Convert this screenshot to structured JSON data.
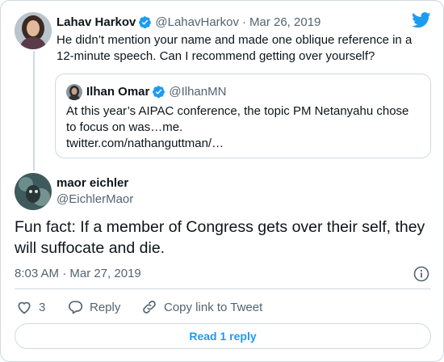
{
  "colors": {
    "twitter_blue": "#1d9bf0",
    "muted_text": "#536471",
    "border": "#cfd9de"
  },
  "parent_tweet": {
    "author_name": "Lahav Harkov",
    "handle": "@LahavHarkov",
    "separator": "·",
    "date": "Mar 26, 2019",
    "verified_icon": "verified-badge-icon",
    "text": "He didn’t mention your name and made one oblique reference in a 12-minute speech. Can I recommend getting over yourself?"
  },
  "quoted_tweet": {
    "author_name": "Ilhan Omar",
    "handle": "@IlhanMN",
    "verified_icon": "verified-badge-icon",
    "text": "At this year’s AIPAC conference, the topic PM Netanyahu chose to focus on was…me.",
    "link": "twitter.com/nathanguttman/…"
  },
  "main_tweet": {
    "author_name": "maor eichler",
    "handle": "@EichlerMaor",
    "text": "Fun fact: If a member of Congress gets over their self, they will suffocate and die.",
    "timestamp": "8:03 AM · Mar 27, 2019"
  },
  "actions": {
    "like_count": "3",
    "reply_label": "Reply",
    "copy_link_label": "Copy link to Tweet"
  },
  "read_replies_label": "Read 1 reply",
  "brand_icon": "twitter-bird-icon",
  "info_icon": "info-icon"
}
